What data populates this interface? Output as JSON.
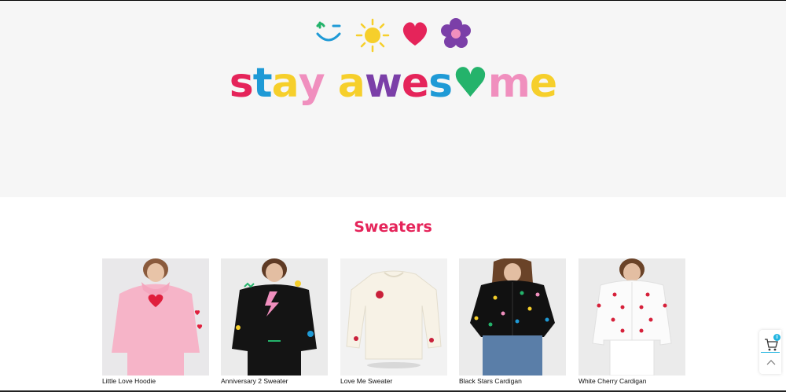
{
  "hero": {
    "brand_text": [
      "s",
      "t",
      "a",
      "y",
      " ",
      "a",
      "w",
      "e",
      "s",
      "♥",
      "m",
      "e"
    ],
    "brand_colors": [
      "#e5245a",
      "#1f9ad6",
      "#f6cf2b",
      "#f08fbe",
      "",
      "#f6cf2b",
      "#7b3fa8",
      "#e5245a",
      "#1f9ad6",
      "#24b36b",
      "#f08fbe",
      "#f6cf2b"
    ],
    "icons": [
      "smiley-wink-icon",
      "sun-icon",
      "heart-icon",
      "flower-icon"
    ]
  },
  "section": {
    "title": "Sweaters"
  },
  "products": [
    {
      "name": "Little Love Hoodie"
    },
    {
      "name": "Anniversary 2 Sweater"
    },
    {
      "name": "Love Me Sweater"
    },
    {
      "name": "Black Stars Cardigan"
    },
    {
      "name": "White Cherry Cardigan"
    }
  ],
  "cart": {
    "count": "0"
  },
  "colors": {
    "accent": "#e5245a",
    "hero_bg": "#f6f6f6",
    "badge": "#1fb4e0"
  }
}
